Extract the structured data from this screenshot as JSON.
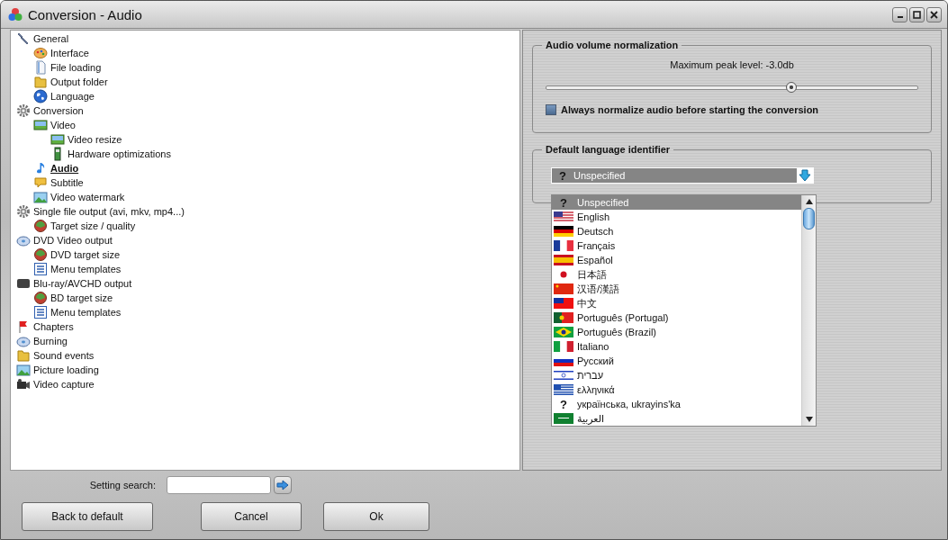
{
  "window": {
    "title": "Conversion - Audio"
  },
  "tree": [
    {
      "label": "General",
      "selected": false,
      "children": [
        {
          "label": "Interface",
          "selected": false
        },
        {
          "label": "File loading",
          "selected": false
        },
        {
          "label": "Output folder",
          "selected": false
        },
        {
          "label": "Language",
          "selected": false
        }
      ]
    },
    {
      "label": "Conversion",
      "selected": false,
      "children": [
        {
          "label": "Video",
          "selected": false,
          "children": [
            {
              "label": "Video resize",
              "selected": false
            },
            {
              "label": "Hardware optimizations",
              "selected": false
            }
          ]
        },
        {
          "label": "Audio",
          "selected": true
        },
        {
          "label": "Subtitle",
          "selected": false
        },
        {
          "label": "Video watermark",
          "selected": false
        }
      ]
    },
    {
      "label": "Single file output (avi, mkv, mp4...)",
      "selected": false,
      "children": [
        {
          "label": "Target size / quality",
          "selected": false
        }
      ]
    },
    {
      "label": "DVD Video output",
      "selected": false,
      "children": [
        {
          "label": "DVD target size",
          "selected": false
        },
        {
          "label": "Menu templates",
          "selected": false
        }
      ]
    },
    {
      "label": "Blu-ray/AVCHD output",
      "selected": false,
      "children": [
        {
          "label": "BD target size",
          "selected": false
        },
        {
          "label": "Menu templates",
          "selected": false
        }
      ]
    },
    {
      "label": "Chapters",
      "selected": false
    },
    {
      "label": "Burning",
      "selected": false
    },
    {
      "label": "Sound events",
      "selected": false
    },
    {
      "label": "Picture loading",
      "selected": false
    },
    {
      "label": "Video capture",
      "selected": false
    }
  ],
  "normalization": {
    "title": "Audio volume normalization",
    "reading": "Maximum peak level: -3.0db",
    "level": 0.66,
    "checkbox": {
      "label": "Always normalize audio before starting the conversion",
      "checked": false
    }
  },
  "language": {
    "title": "Default language identifier",
    "dropdown": {
      "glyph": "?",
      "value": "Unspecified",
      "expanded": true
    },
    "options": [
      {
        "label": "Unspecified",
        "glyph": "?",
        "selected": true
      },
      {
        "label": "English",
        "selected": false
      },
      {
        "label": "Deutsch",
        "selected": false
      },
      {
        "label": "Français",
        "selected": false
      },
      {
        "label": "Español",
        "selected": false
      },
      {
        "label": "日本語",
        "selected": false
      },
      {
        "label": "汉语/漢語",
        "selected": false
      },
      {
        "label": "中文",
        "selected": false
      },
      {
        "label": "Português (Portugal)",
        "selected": false
      },
      {
        "label": "Português (Brazil)",
        "selected": false
      },
      {
        "label": "Italiano",
        "selected": false
      },
      {
        "label": "Русский",
        "selected": false
      },
      {
        "label": "עברית",
        "selected": false
      },
      {
        "label": "ελληνικά",
        "selected": false
      },
      {
        "label": "українська, ukrayins'ka",
        "glyph": "?",
        "selected": false
      },
      {
        "label": "العربية",
        "selected": false
      }
    ]
  },
  "search": {
    "label": "Setting search:"
  },
  "buttons": [
    "Back to default",
    "Cancel",
    "Ok"
  ]
}
